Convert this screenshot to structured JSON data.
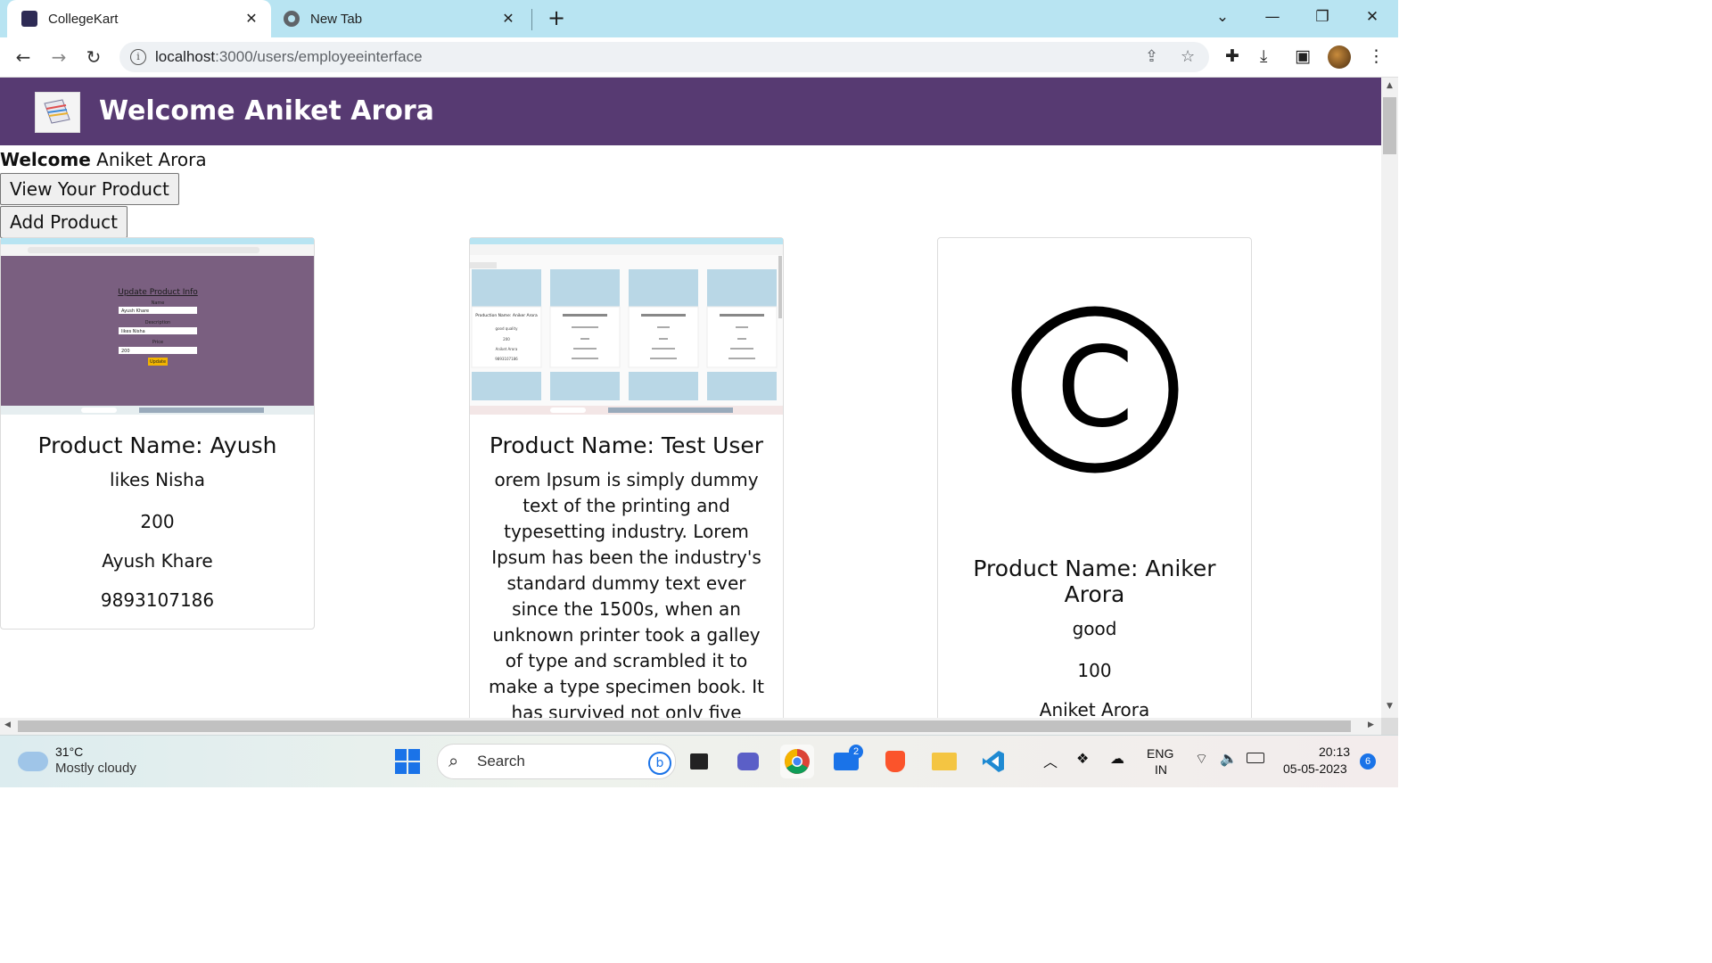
{
  "browser": {
    "tabs": [
      {
        "label": "CollegeKart",
        "active": true
      },
      {
        "label": "New Tab",
        "active": false
      }
    ],
    "url_host": "localhost",
    "url_path": ":3000/users/employeeinterface"
  },
  "app": {
    "title": "Welcome Aniket Arora",
    "welcome_bold": "Welcome",
    "welcome_name": "Aniket Arora",
    "buttons": {
      "view": "View Your Product",
      "add": "Add Product"
    }
  },
  "products": [
    {
      "name": "Product Name: Ayush",
      "description": "likes Nisha",
      "price": "200",
      "seller": "Ayush Khare",
      "phone": "9893107186",
      "thumb": {
        "title": "Update Product Info",
        "labels": [
          "Name",
          "Description",
          "Price"
        ],
        "values": [
          "Ayush Khare",
          "likes Nisha",
          "200"
        ],
        "button": "Update"
      }
    },
    {
      "name": "Product Name: Test User",
      "description": "orem Ipsum is simply dummy text of the printing and typesetting industry. Lorem Ipsum has been the industry's standard dummy text ever since the 1500s, when an unknown printer took a galley of type and scrambled it to make a type specimen book. It has survived not only five centuries, but also the leap into e",
      "thumb": {
        "card_title": "Production Name: Aniker Arora",
        "card_desc": "good quality",
        "card_price": "200",
        "card_seller": "Aniket Arora",
        "card_phone": "9893107186"
      }
    },
    {
      "name": "Product Name: Aniker Arora",
      "description": "good",
      "price": "100",
      "seller": "Aniket Arora"
    }
  ],
  "taskbar": {
    "temp": "31°C",
    "condition": "Mostly cloudy",
    "search_placeholder": "Search",
    "mail_badge": "2",
    "lang_top": "ENG",
    "lang_bottom": "IN",
    "time": "20:13",
    "date": "05-05-2023",
    "notif_count": "6"
  }
}
